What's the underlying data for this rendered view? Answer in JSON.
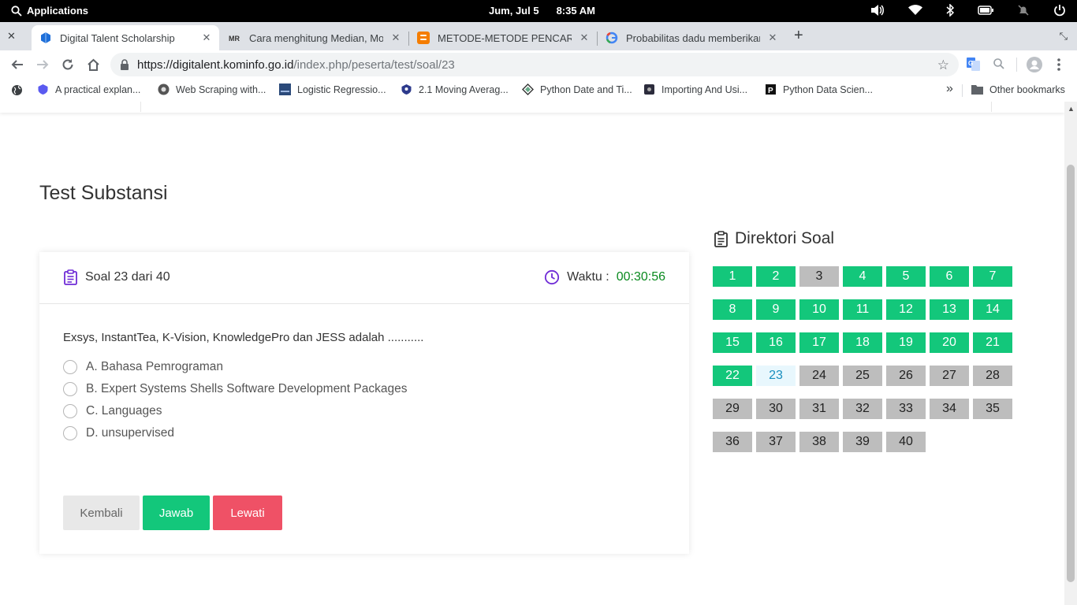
{
  "system_bar": {
    "apps_label": "Applications",
    "date": "Jum, Jul  5",
    "time": "8:35 AM"
  },
  "tabs": [
    {
      "title": "Digital Talent Scholarship",
      "favicon": "digitalent-favicon",
      "active": true
    },
    {
      "title": "Cara menghitung Median, Mod",
      "favicon": "mrk-favicon",
      "active": false
    },
    {
      "title": "METODE-METODE PENCARIAN",
      "favicon": "blogger-favicon",
      "active": false
    },
    {
      "title": "Probabilitas dadu memberikan",
      "favicon": "google-favicon",
      "active": false
    }
  ],
  "address_bar": {
    "url_host": "https://digitalent.kominfo.go.id",
    "url_path": "/index.php/peserta/test/soal/23"
  },
  "bookmarks": [
    "A practical explan...",
    "Web Scraping with...",
    "Logistic Regressio...",
    "2.1 Moving Averag...",
    "Python Date and Ti...",
    "Importing And Usi...",
    "Python Data Scien..."
  ],
  "bookmarks_overflow": "»",
  "other_bookmarks": "Other bookmarks",
  "page": {
    "title": "Test Substansi",
    "question_counter": "Soal 23 dari 40",
    "timer_label": "Waktu :",
    "timer_value": "00:30:56",
    "question": "Exsys, InstantTea, K-Vision, KnowledgePro dan JESS adalah ...........",
    "options": [
      "A. Bahasa Pemrograman",
      "B. Expert Systems Shells Software Development Packages",
      "C. Languages",
      "D. unsupervised"
    ],
    "buttons": {
      "back": "Kembali",
      "answer": "Jawab",
      "skip": "Lewati"
    },
    "directory_title": "Direktori Soal"
  },
  "question_numbers": [
    {
      "n": "1",
      "status": "answered"
    },
    {
      "n": "2",
      "status": "answered"
    },
    {
      "n": "3",
      "status": "pending"
    },
    {
      "n": "4",
      "status": "answered"
    },
    {
      "n": "5",
      "status": "answered"
    },
    {
      "n": "6",
      "status": "answered"
    },
    {
      "n": "7",
      "status": "answered"
    },
    {
      "n": "8",
      "status": "answered"
    },
    {
      "n": "9",
      "status": "answered"
    },
    {
      "n": "10",
      "status": "answered"
    },
    {
      "n": "11",
      "status": "answered"
    },
    {
      "n": "12",
      "status": "answered"
    },
    {
      "n": "13",
      "status": "answered"
    },
    {
      "n": "14",
      "status": "answered"
    },
    {
      "n": "15",
      "status": "answered"
    },
    {
      "n": "16",
      "status": "answered"
    },
    {
      "n": "17",
      "status": "answered"
    },
    {
      "n": "18",
      "status": "answered"
    },
    {
      "n": "19",
      "status": "answered"
    },
    {
      "n": "20",
      "status": "answered"
    },
    {
      "n": "21",
      "status": "answered"
    },
    {
      "n": "22",
      "status": "answered"
    },
    {
      "n": "23",
      "status": "current"
    },
    {
      "n": "24",
      "status": "pending"
    },
    {
      "n": "25",
      "status": "pending"
    },
    {
      "n": "26",
      "status": "pending"
    },
    {
      "n": "27",
      "status": "pending"
    },
    {
      "n": "28",
      "status": "pending"
    },
    {
      "n": "29",
      "status": "pending"
    },
    {
      "n": "30",
      "status": "pending"
    },
    {
      "n": "31",
      "status": "pending"
    },
    {
      "n": "32",
      "status": "pending"
    },
    {
      "n": "33",
      "status": "pending"
    },
    {
      "n": "34",
      "status": "pending"
    },
    {
      "n": "35",
      "status": "pending"
    },
    {
      "n": "36",
      "status": "pending"
    },
    {
      "n": "37",
      "status": "pending"
    },
    {
      "n": "38",
      "status": "pending"
    },
    {
      "n": "39",
      "status": "pending"
    },
    {
      "n": "40",
      "status": "pending"
    }
  ],
  "colors": {
    "answered": "#13c77b",
    "current": "#e8f7fd",
    "pending": "#bdbdbd",
    "skip": "#ef5166",
    "accent_icon": "#6f2bd6",
    "timer_value": "#0a8a1f"
  }
}
